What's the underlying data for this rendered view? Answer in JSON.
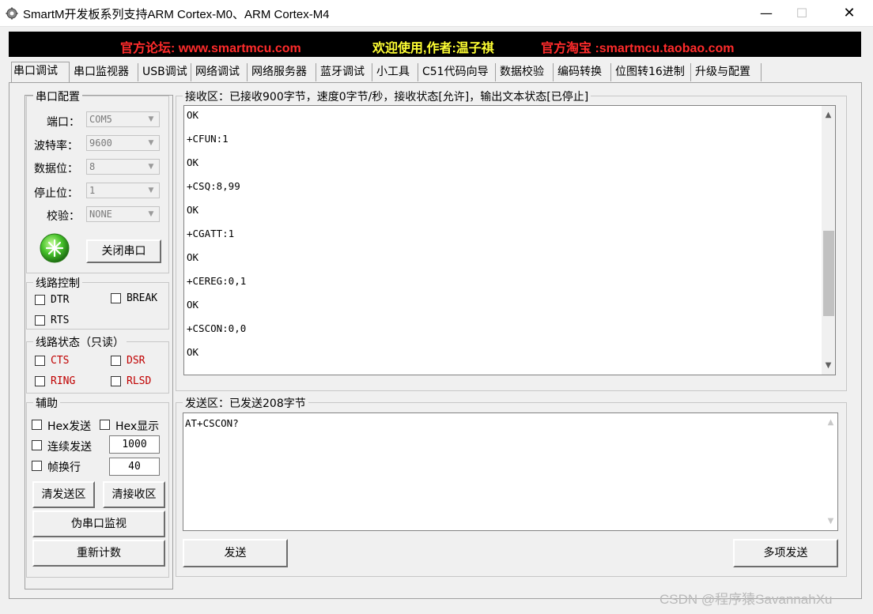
{
  "window": {
    "title": "SmartM开发板系列支持ARM Cortex-M0、ARM Cortex-M4",
    "min_glyph": "—",
    "max_glyph": "☐",
    "close_glyph": "✕"
  },
  "banner": {
    "forum": "官方论坛: www.smartmcu.com",
    "welcome": "欢迎使用,作者:温子祺",
    "shop": "官方淘宝 :smartmcu.taobao.com"
  },
  "tabs": [
    "串口调试",
    "串口监视器",
    "USB调试",
    "网络调试",
    "网络服务器",
    "蓝牙调试",
    "小工具",
    "C51代码向导",
    "数据校验",
    "编码转换",
    "位图转16进制",
    "升级与配置"
  ],
  "serial_config": {
    "title": "串口配置",
    "port_label": "端口：",
    "port_value": "COM5",
    "baud_label": "波特率：",
    "baud_value": "9600",
    "databits_label": "数据位：",
    "databits_value": "8",
    "stopbits_label": "停止位：",
    "stopbits_value": "1",
    "parity_label": "校验：",
    "parity_value": "NONE",
    "close_button": "关闭串口",
    "status_icon": "port-open-indicator-icon"
  },
  "line_control": {
    "title": "线路控制",
    "dtr": "DTR",
    "break": "BREAK",
    "rts": "RTS"
  },
  "line_status": {
    "title": "线路状态（只读）",
    "cts": "CTS",
    "dsr": "DSR",
    "ring": "RING",
    "rlsd": "RLSD",
    "color": "#c00000"
  },
  "aux": {
    "title": "辅助",
    "hex_send": "Hex发送",
    "hex_display": "Hex显示",
    "continuous_send": "连续发送",
    "continuous_value": "1000",
    "frame_newline": "帧换行",
    "frame_value": "40",
    "clear_send": "清发送区",
    "clear_receive": "清接收区",
    "pseudo_monitor": "伪串口监视",
    "recount": "重新计数"
  },
  "receive": {
    "title": "接收区：已接收900字节，速度0字节/秒，接收状态[允许]，输出文本状态[已停止]",
    "lines": [
      "OK",
      "+CFUN:1",
      "OK",
      "+CSQ:8,99",
      "OK",
      "+CGATT:1",
      "OK",
      "+CEREG:0,1",
      "OK",
      "+CSCON:0,0",
      "OK"
    ],
    "scroll_position": 0.72
  },
  "send": {
    "title": "发送区：已发送208字节",
    "text": "AT+CSCON?",
    "send_button": "发送",
    "multi_send_button": "多项发送"
  },
  "watermark": "CSDN @程序猿SavannahXu"
}
